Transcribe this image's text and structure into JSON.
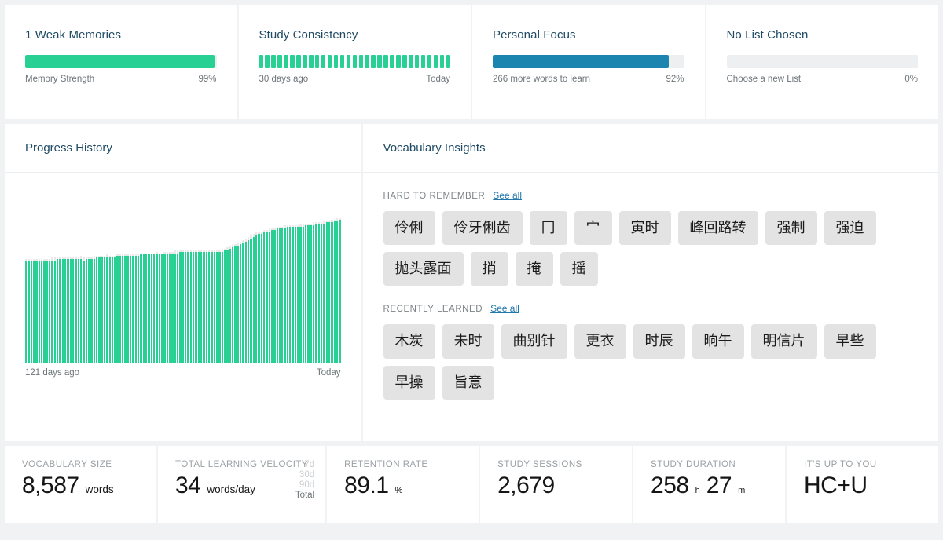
{
  "summary_cards": [
    {
      "title": "1 Weak Memories",
      "footer_left": "Memory Strength",
      "footer_right": "99%",
      "percent": 99,
      "fill_color": "#28d094",
      "type": "bar"
    },
    {
      "title": "Study Consistency",
      "footer_left": "30 days ago",
      "footer_right": "Today",
      "fill_color": "#28d094",
      "type": "streak",
      "streak_days": [
        100,
        100,
        100,
        100,
        100,
        100,
        100,
        100,
        100,
        100,
        100,
        100,
        100,
        100,
        100,
        100,
        100,
        100,
        100,
        100,
        100,
        100,
        100,
        100,
        100,
        100,
        100,
        100,
        100,
        100,
        100
      ]
    },
    {
      "title": "Personal Focus",
      "footer_left": "266 more words to learn",
      "footer_right": "92%",
      "percent": 92,
      "fill_color": "#1b85b0",
      "type": "bar"
    },
    {
      "title": "No List Chosen",
      "footer_left": "Choose a new List",
      "footer_right": "0%",
      "percent": 0,
      "fill_color": "#28d094",
      "type": "bar"
    }
  ],
  "history_panel": {
    "title": "Progress History",
    "axis_left": "121 days ago",
    "axis_right": "Today"
  },
  "insights_panel": {
    "title": "Vocabulary Insights",
    "groups": [
      {
        "label": "Hard to Remember",
        "see_all": "See all",
        "words": [
          "伶俐",
          "伶牙俐齿",
          "冂",
          "宀",
          "寅时",
          "峰回路转",
          "强制",
          "强迫",
          "抛头露面",
          "捎",
          "掩",
          "摇"
        ]
      },
      {
        "label": "Recently Learned",
        "see_all": "See all",
        "words": [
          "木炭",
          "未时",
          "曲别针",
          "更衣",
          "时辰",
          "晌午",
          "明信片",
          "早些",
          "早操",
          "旨意"
        ]
      }
    ]
  },
  "stats": [
    {
      "label": "Vocabulary Size",
      "value": "8,587",
      "unit": "words",
      "unit_size": "normal"
    },
    {
      "label": "Total Learning Velocity",
      "value": "34",
      "unit": "words/day",
      "unit_size": "normal",
      "ranges": [
        {
          "label": "7d",
          "selected": false
        },
        {
          "label": "30d",
          "selected": false
        },
        {
          "label": "90d",
          "selected": false
        },
        {
          "label": "Total",
          "selected": true
        }
      ]
    },
    {
      "label": "Retention Rate",
      "value": "89.1",
      "unit": "%",
      "unit_size": "small"
    },
    {
      "label": "Study Sessions",
      "value": "2,679",
      "unit": "",
      "unit_size": "normal"
    },
    {
      "label": "Study Duration",
      "value": "258",
      "unit": "h",
      "unit_size": "small",
      "value2": "27",
      "unit2": "m"
    },
    {
      "label": "It's up to you",
      "value": "HC+U",
      "unit": "",
      "unit_size": "normal"
    }
  ],
  "chart_data": {
    "type": "bar",
    "title": "Progress History",
    "xlabel": "",
    "ylabel": "",
    "x_tick_labels": [
      "121 days ago",
      "Today"
    ],
    "grid": false,
    "legend": null,
    "ylim": [
      0,
      100
    ],
    "categories": [
      "d1",
      "d2",
      "d3",
      "d4",
      "d5",
      "d6",
      "d7",
      "d8",
      "d9",
      "d10",
      "d11",
      "d12",
      "d13",
      "d14",
      "d15",
      "d16",
      "d17",
      "d18",
      "d19",
      "d20",
      "d21",
      "d22",
      "d23",
      "d24",
      "d25",
      "d26",
      "d27",
      "d28",
      "d29",
      "d30",
      "d31",
      "d32",
      "d33",
      "d34",
      "d35",
      "d36",
      "d37",
      "d38",
      "d39",
      "d40",
      "d41",
      "d42",
      "d43",
      "d44",
      "d45",
      "d46",
      "d47",
      "d48",
      "d49",
      "d50",
      "d51",
      "d52",
      "d53",
      "d54",
      "d55",
      "d56",
      "d57",
      "d58",
      "d59",
      "d60",
      "d61",
      "d62",
      "d63",
      "d64",
      "d65",
      "d66",
      "d67",
      "d68",
      "d69",
      "d70",
      "d71",
      "d72",
      "d73",
      "d74",
      "d75",
      "d76",
      "d77",
      "d78",
      "d79",
      "d80",
      "d81",
      "d82",
      "d83",
      "d84",
      "d85",
      "d86",
      "d87",
      "d88",
      "d89",
      "d90",
      "d91",
      "d92",
      "d93",
      "d94",
      "d95",
      "d96",
      "d97",
      "d98",
      "d99",
      "d100",
      "d101",
      "d102",
      "d103",
      "d104",
      "d105",
      "d106",
      "d107",
      "d108",
      "d109",
      "d110",
      "d111",
      "d112",
      "d113",
      "d114",
      "d115",
      "d116",
      "d117",
      "d118",
      "d119",
      "d120",
      "d121"
    ],
    "values": [
      70,
      70,
      70,
      70,
      70,
      70,
      70,
      70,
      70,
      70,
      70,
      70,
      71,
      71,
      71,
      71,
      71,
      71,
      71,
      71,
      71,
      71,
      70,
      71,
      71,
      71,
      71,
      72,
      72,
      72,
      72,
      72,
      72,
      72,
      72,
      73,
      73,
      73,
      73,
      73,
      73,
      73,
      73,
      73,
      74,
      74,
      74,
      74,
      74,
      74,
      74,
      74,
      74,
      75,
      75,
      75,
      75,
      75,
      75,
      76,
      76,
      76,
      76,
      76,
      76,
      76,
      76,
      76,
      76,
      76,
      76,
      76,
      76,
      76,
      76,
      76,
      77,
      77,
      78,
      79,
      80,
      80,
      81,
      82,
      83,
      84,
      85,
      86,
      87,
      88,
      88,
      89,
      90,
      90,
      91,
      91,
      92,
      92,
      92,
      92,
      93,
      93,
      93,
      93,
      93,
      93,
      93,
      94,
      94,
      94,
      94,
      95,
      95,
      95,
      95,
      96,
      96,
      96,
      97,
      97,
      98
    ],
    "ghost_values": [
      71,
      71,
      71,
      71,
      71,
      71,
      71,
      71,
      71,
      71,
      72,
      72,
      72,
      72,
      72,
      72,
      72,
      72,
      72,
      72,
      72,
      73,
      72,
      72,
      72,
      72,
      73,
      73,
      73,
      73,
      73,
      74,
      73,
      73,
      73,
      74,
      74,
      74,
      74,
      74,
      74,
      74,
      74,
      75,
      75,
      75,
      75,
      75,
      75,
      75,
      76,
      75,
      75,
      76,
      76,
      76,
      76,
      77,
      77,
      77,
      77,
      77,
      77,
      77,
      77,
      77,
      77,
      77,
      77,
      77,
      77,
      77,
      77,
      77,
      77,
      78,
      78,
      79,
      80,
      81,
      81,
      82,
      83,
      84,
      85,
      86,
      87,
      88,
      89,
      89,
      90,
      91,
      91,
      92,
      92,
      92,
      93,
      93,
      93,
      94,
      94,
      94,
      94,
      94,
      94,
      95,
      95,
      95,
      95,
      95,
      96,
      96,
      96,
      96,
      97,
      97,
      97,
      98,
      98,
      99,
      99
    ],
    "bar_color": "#28d094",
    "ghost_color": "#e9e9ec"
  },
  "consistency_chart": {
    "type": "bar",
    "title": "Study Consistency",
    "categories_count": 31,
    "values": [
      1,
      1,
      1,
      1,
      1,
      1,
      1,
      1,
      1,
      1,
      1,
      1,
      1,
      1,
      1,
      1,
      1,
      1,
      1,
      1,
      1,
      1,
      1,
      1,
      1,
      1,
      1,
      1,
      1,
      1,
      1
    ],
    "bar_color": "#28d094"
  }
}
